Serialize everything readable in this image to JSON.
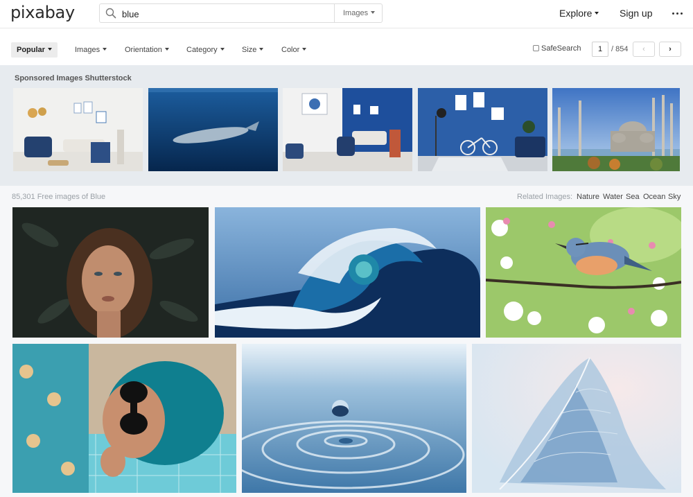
{
  "header": {
    "logo": "pixabay",
    "search_value": "blue",
    "search_type": "Images",
    "explore": "Explore",
    "signup": "Sign up",
    "more_icon": "more-dots-icon"
  },
  "filters": {
    "items": [
      "Popular",
      "Images",
      "Orientation",
      "Category",
      "Size",
      "Color"
    ],
    "safesearch": "SafeSearch",
    "page": "1",
    "page_total": "/ 854",
    "prev": "‹",
    "next": "›"
  },
  "sponsored": {
    "title": "Sponsored Images Shutterstock",
    "images": [
      "living room with blue armchair",
      "whale underwater",
      "living room with blue wall",
      "blue room with bicycle",
      "blue mosque istanbul"
    ]
  },
  "results": {
    "count": "85,301 Free images of Blue",
    "related_label": "Related Images:",
    "related": [
      "Nature",
      "Water",
      "Sea",
      "Ocean",
      "Sky"
    ],
    "images": [
      "woman portrait",
      "ocean wave",
      "bird on blossom branch",
      "woman with blue hair",
      "water drop",
      "feather"
    ]
  },
  "colors": {
    "accent": "#2b2b2b",
    "sponsored_bg": "#e7ebef",
    "results_bg": "#f6f7f9"
  }
}
